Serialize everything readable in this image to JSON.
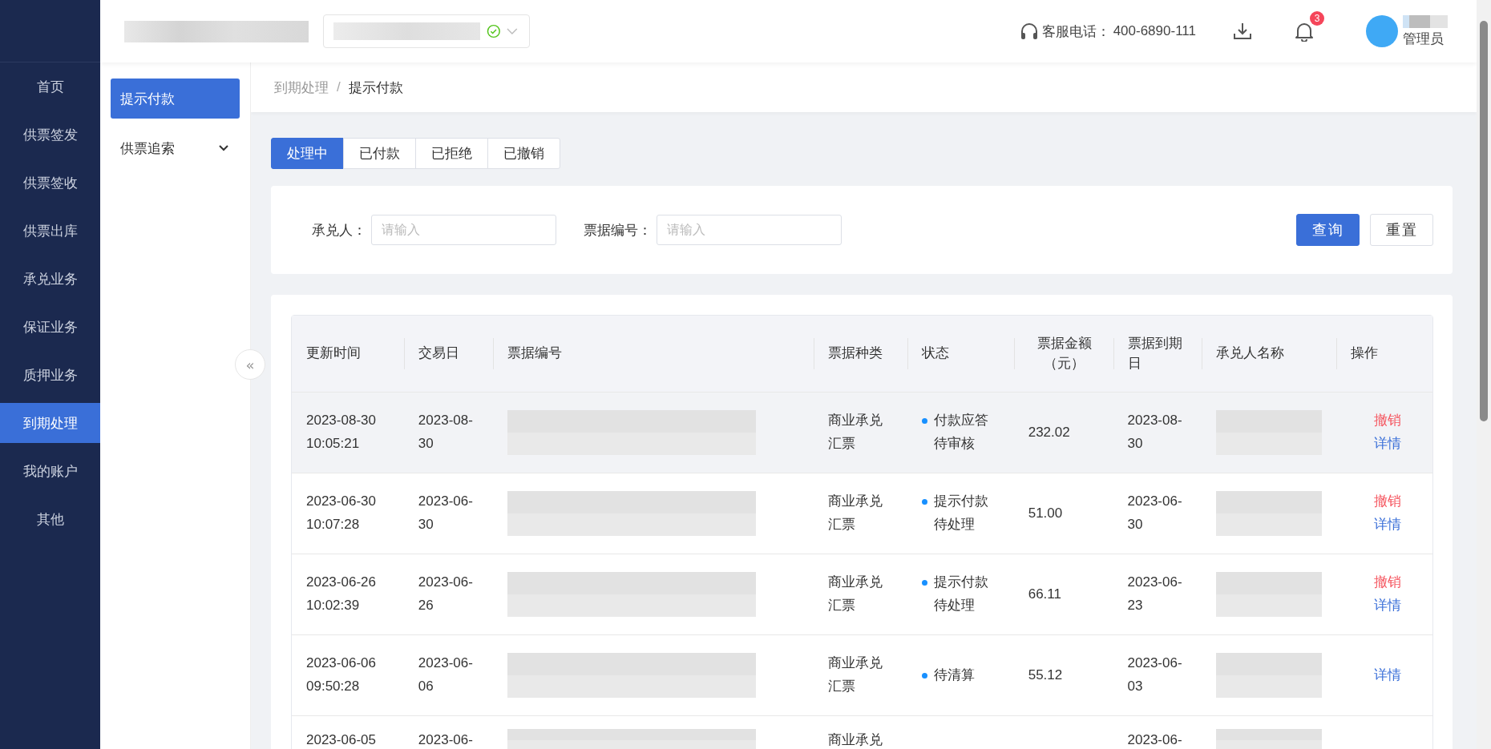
{
  "nav": {
    "items": [
      {
        "label": "首页",
        "selected": false
      },
      {
        "label": "供票签发",
        "selected": false
      },
      {
        "label": "供票签收",
        "selected": false
      },
      {
        "label": "供票出库",
        "selected": false
      },
      {
        "label": "承兑业务",
        "selected": false
      },
      {
        "label": "保证业务",
        "selected": false
      },
      {
        "label": "质押业务",
        "selected": false
      },
      {
        "label": "到期处理",
        "selected": true
      },
      {
        "label": "我的账户",
        "selected": false
      },
      {
        "label": "其他",
        "selected": false
      }
    ]
  },
  "header": {
    "hotline_label": "客服电话：",
    "hotline_number": "400-6890-111",
    "notification_count": "3",
    "user_role": "管理员"
  },
  "subnav": {
    "items": [
      {
        "label": "提示付款",
        "selected": true
      },
      {
        "label": "供票追索",
        "selected": false,
        "expanded": false
      }
    ]
  },
  "collapse_button": "«",
  "breadcrumb": {
    "items": [
      "到期处理",
      "提示付款"
    ],
    "separator": "/"
  },
  "tabs": [
    {
      "label": "处理中",
      "selected": true
    },
    {
      "label": "已付款",
      "selected": false
    },
    {
      "label": "已拒绝",
      "selected": false
    },
    {
      "label": "已撤销",
      "selected": false
    }
  ],
  "filters": [
    {
      "label": "承兑人：",
      "placeholder": "请输入"
    },
    {
      "label": "票据编号：",
      "placeholder": "请输入"
    }
  ],
  "buttons": [
    {
      "label": "查询",
      "kind": "primary"
    },
    {
      "label": "重置",
      "kind": "default"
    }
  ],
  "table": {
    "columns": [
      "更新时间",
      "交易日",
      "票据编号",
      "票据种类",
      "状态",
      "票据金额（元）",
      "票据到期日",
      "承兑人名称",
      "操作"
    ],
    "rows": [
      {
        "hovered": true,
        "updated": [
          "2023-08-30",
          "10:05:21"
        ],
        "trade_date": [
          "2023-08-",
          "30"
        ],
        "type": [
          "商业承兑",
          "汇票"
        ],
        "status": [
          "付款应答",
          "待审核"
        ],
        "amount": "232.02",
        "due_date": [
          "2023-08-",
          "30"
        ],
        "actions": [
          {
            "label": "撤销",
            "kind": "cancel"
          },
          {
            "label": "详情",
            "kind": "detail"
          }
        ]
      },
      {
        "hovered": false,
        "updated": [
          "2023-06-30",
          "10:07:28"
        ],
        "trade_date": [
          "2023-06-",
          "30"
        ],
        "type": [
          "商业承兑",
          "汇票"
        ],
        "status": [
          "提示付款",
          "待处理"
        ],
        "amount": "51.00",
        "due_date": [
          "2023-06-",
          "30"
        ],
        "actions": [
          {
            "label": "撤销",
            "kind": "cancel"
          },
          {
            "label": "详情",
            "kind": "detail"
          }
        ]
      },
      {
        "hovered": false,
        "updated": [
          "2023-06-26",
          "10:02:39"
        ],
        "trade_date": [
          "2023-06-",
          "26"
        ],
        "type": [
          "商业承兑",
          "汇票"
        ],
        "status": [
          "提示付款",
          "待处理"
        ],
        "amount": "66.11",
        "due_date": [
          "2023-06-",
          "23"
        ],
        "actions": [
          {
            "label": "撤销",
            "kind": "cancel"
          },
          {
            "label": "详情",
            "kind": "detail"
          }
        ]
      },
      {
        "hovered": false,
        "updated": [
          "2023-06-06",
          "09:50:28"
        ],
        "trade_date": [
          "2023-06-",
          "06"
        ],
        "type": [
          "商业承兑",
          "汇票"
        ],
        "status": [
          "待清算"
        ],
        "amount": "55.12",
        "due_date": [
          "2023-06-",
          "03"
        ],
        "actions": [
          {
            "label": "详情",
            "kind": "detail"
          }
        ]
      },
      {
        "hovered": false,
        "updated": [
          "2023-06-05"
        ],
        "trade_date": [
          "2023-06-"
        ],
        "type": [
          "商业承兑"
        ],
        "due_date": [
          "2023-06-"
        ]
      }
    ]
  }
}
